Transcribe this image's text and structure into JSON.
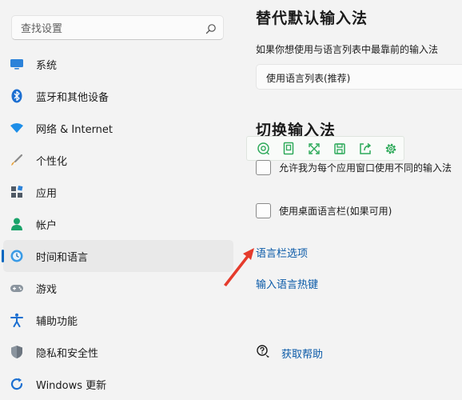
{
  "sidebar": {
    "search_placeholder": "查找设置",
    "items": [
      {
        "label": "系统",
        "icon": "monitor-icon"
      },
      {
        "label": "蓝牙和其他设备",
        "icon": "bluetooth-icon"
      },
      {
        "label": "网络 & Internet",
        "icon": "wifi-icon"
      },
      {
        "label": "个性化",
        "icon": "brush-icon"
      },
      {
        "label": "应用",
        "icon": "apps-icon"
      },
      {
        "label": "帐户",
        "icon": "person-icon"
      },
      {
        "label": "时间和语言",
        "icon": "globe-clock-icon",
        "selected": true
      },
      {
        "label": "游戏",
        "icon": "gamepad-icon"
      },
      {
        "label": "辅助功能",
        "icon": "accessibility-icon"
      },
      {
        "label": "隐私和安全性",
        "icon": "shield-icon"
      },
      {
        "label": "Windows 更新",
        "icon": "update-icon"
      }
    ]
  },
  "main": {
    "default_input_title": "替代默认输入法",
    "default_input_desc": "如果你想使用与语言列表中最靠前的输入法",
    "default_input_select": "使用语言列表(推荐)",
    "switch_title": "切换输入法",
    "checkbox_per_app": "允许我为每个应用窗口使用不同的输入法",
    "checkbox_desktop_bar": "使用桌面语言栏(如果可用)",
    "link_language_bar": "语言栏选项",
    "link_hotkeys": "输入语言热键",
    "help_label": "获取帮助"
  },
  "floating_toolbar": {
    "icons": [
      "ocr-icon",
      "copy-icon",
      "expand-icon",
      "save-icon",
      "share-icon",
      "settings-icon"
    ]
  },
  "colors": {
    "accent": "#0067c0",
    "link": "#0a5aa8",
    "toolbar_icon": "#2eaa5a",
    "annotation_arrow": "#e53b2c"
  }
}
